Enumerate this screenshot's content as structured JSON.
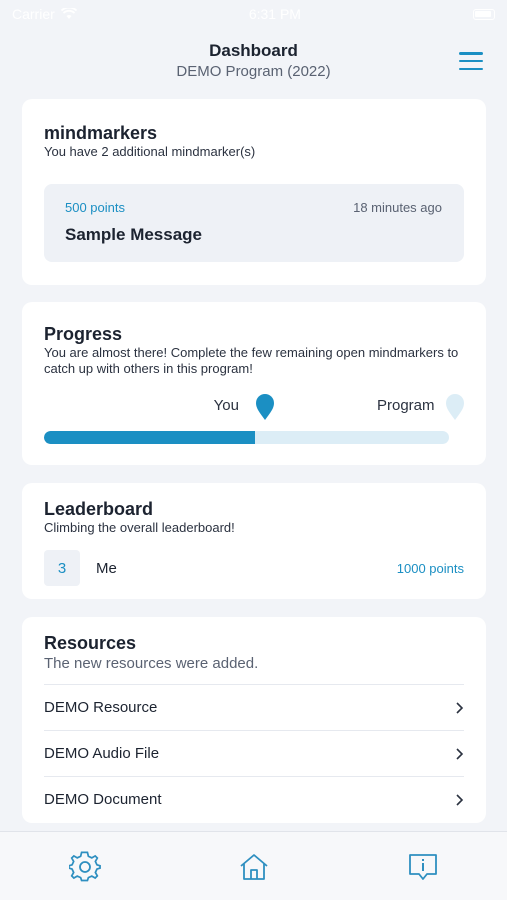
{
  "status_bar": {
    "carrier": "Carrier",
    "time": "6:31 PM"
  },
  "header": {
    "title": "Dashboard",
    "subtitle": "DEMO Program (2022)",
    "menu_icon": "hamburger-icon"
  },
  "mindmarkers": {
    "title": "mindmarkers",
    "description": "You have 2 additional mindmarker(s)",
    "message": {
      "points": "500 points",
      "time": "18 minutes ago",
      "title": "Sample Message"
    }
  },
  "progress": {
    "title": "Progress",
    "description": "You are almost there! Complete the few remaining open mindmarkers to catch up with others in this program!",
    "you_label": "You",
    "program_label": "Program",
    "you_fraction": 0.52,
    "program_fraction": 1.0,
    "colors": {
      "fill": "#1b8fc3",
      "track": "#dcedf6"
    }
  },
  "leaderboard": {
    "title": "Leaderboard",
    "description": "Climbing the overall leaderboard!",
    "entry": {
      "rank": "3",
      "name": "Me",
      "points": "1000 points"
    }
  },
  "resources": {
    "title": "Resources",
    "description": "The new resources were added.",
    "items": [
      {
        "label": "DEMO Resource"
      },
      {
        "label": "DEMO Audio File"
      },
      {
        "label": "DEMO Document"
      }
    ]
  },
  "tab_bar": {
    "tabs": [
      "gear-icon",
      "home-icon",
      "feedback-icon"
    ]
  },
  "colors": {
    "accent": "#1b8fc3",
    "background": "#f2f4f8"
  }
}
